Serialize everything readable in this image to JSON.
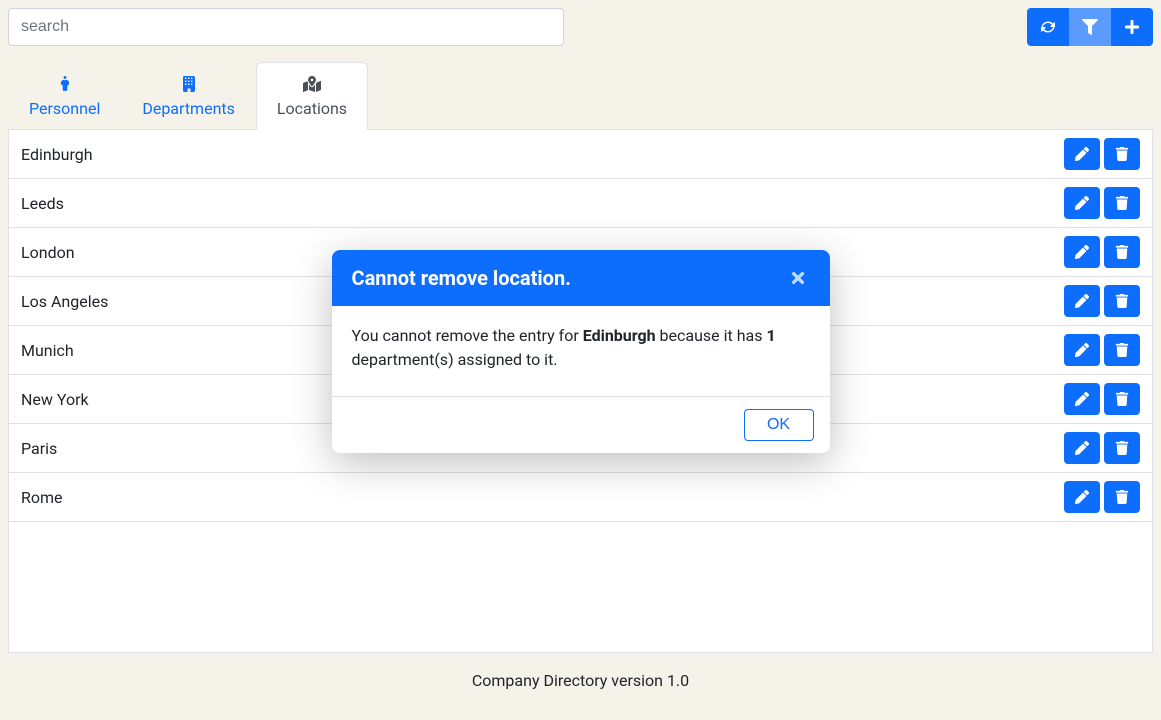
{
  "search": {
    "placeholder": "search"
  },
  "toolbar": {
    "refresh_label": "Refresh",
    "filter_label": "Filter",
    "add_label": "Add"
  },
  "tabs": {
    "personnel": "Personnel",
    "departments": "Departments",
    "locations": "Locations",
    "active": "locations"
  },
  "locations": [
    {
      "name": "Edinburgh"
    },
    {
      "name": "Leeds"
    },
    {
      "name": "London"
    },
    {
      "name": "Los Angeles"
    },
    {
      "name": "Munich"
    },
    {
      "name": "New York"
    },
    {
      "name": "Paris"
    },
    {
      "name": "Rome"
    }
  ],
  "modal": {
    "title": "Cannot remove location.",
    "body_prefix": "You cannot remove the entry for ",
    "body_entity": "Edinburgh",
    "body_mid": " because it has ",
    "body_count": "1",
    "body_suffix": " department(s) assigned to it.",
    "ok_label": "OK"
  },
  "footer": {
    "text": "Company Directory version 1.0"
  }
}
